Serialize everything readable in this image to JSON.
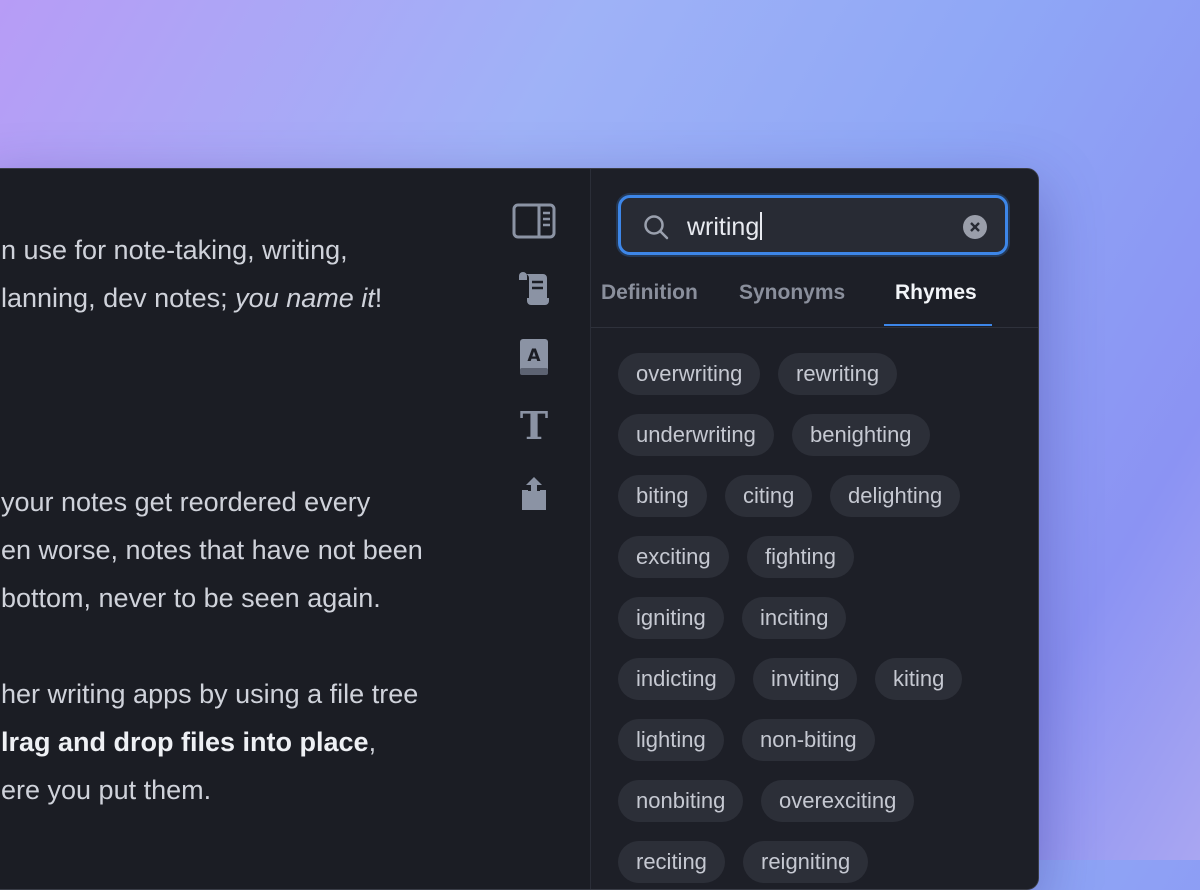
{
  "editor": {
    "lines": [
      {
        "segments": [
          {
            "text": "n use for note-taking, writing,",
            "style": "normal"
          }
        ]
      },
      {
        "segments": [
          {
            "text": "lanning, dev notes; ",
            "style": "normal"
          },
          {
            "text": "you name it",
            "style": "italic"
          },
          {
            "text": "!",
            "style": "normal"
          }
        ]
      },
      {
        "segments": [
          {
            "text": " your notes get reordered every",
            "style": "normal"
          }
        ]
      },
      {
        "segments": [
          {
            "text": "en worse, notes that have not been",
            "style": "normal"
          }
        ]
      },
      {
        "segments": [
          {
            "text": "bottom, never to be seen again.",
            "style": "normal"
          }
        ]
      },
      {
        "segments": [
          {
            "text": "her writing apps by using a file tree",
            "style": "normal"
          }
        ]
      },
      {
        "segments": [
          {
            "text": "lrag and drop files into place",
            "style": "bold"
          },
          {
            "text": ",",
            "style": "normal"
          }
        ]
      },
      {
        "segments": [
          {
            "text": "ere you put them.",
            "style": "normal"
          }
        ]
      }
    ]
  },
  "toolbar": {
    "icons": [
      "toggle-panel-icon",
      "scroll-icon",
      "dictionary-icon",
      "text-format-icon",
      "share-icon"
    ]
  },
  "search": {
    "value": "writing",
    "placeholder": ""
  },
  "tabs": [
    "Definition",
    "Synonyms",
    "Rhymes"
  ],
  "active_tab": "Rhymes",
  "rhymes": [
    "overwriting",
    "rewriting",
    "underwriting",
    "benighting",
    "biting",
    "citing",
    "delighting",
    "exciting",
    "fighting",
    "igniting",
    "inciting",
    "indicting",
    "inviting",
    "kiting",
    "lighting",
    "non-biting",
    "nonbiting",
    "overexciting",
    "reciting",
    "reigniting"
  ],
  "colors": {
    "accent": "#3d86e8",
    "chip_bg": "#2c2f38",
    "panel_bg": "#1d1f27"
  }
}
